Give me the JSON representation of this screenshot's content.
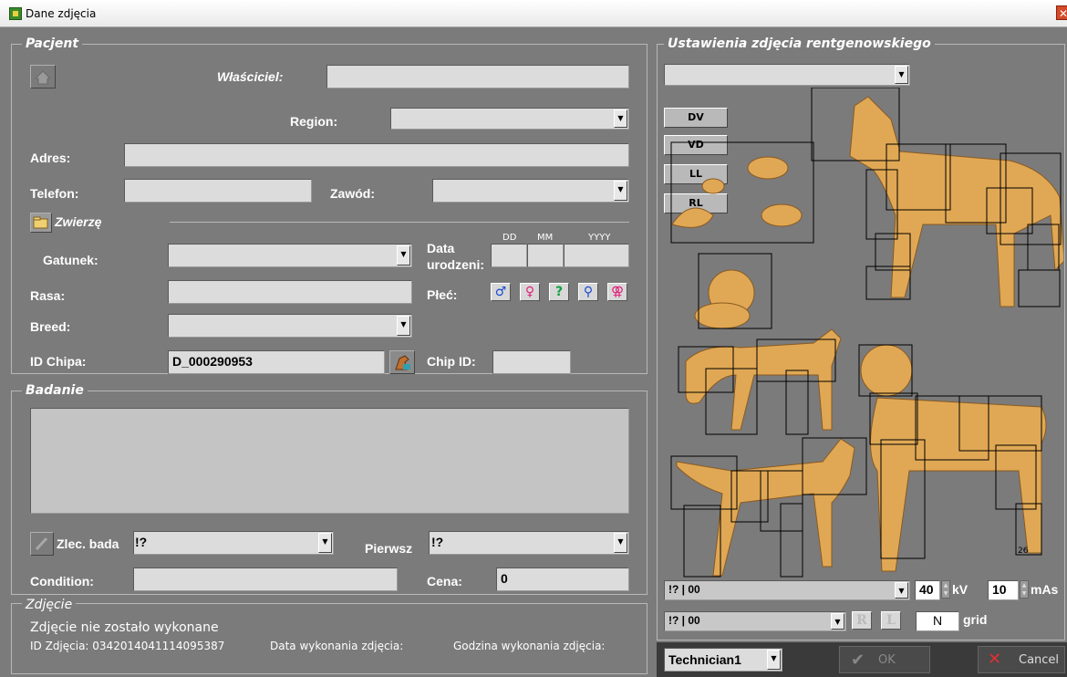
{
  "window": {
    "title": "Dane zdjęcia"
  },
  "patient": {
    "legend": "Pacjent",
    "owner_label": "Właściciel:",
    "owner_value": "",
    "region_label": "Region:",
    "region_value": "",
    "address_label": "Adres:",
    "address_value": "",
    "phone_label": "Telefon:",
    "phone_value": "",
    "profession_label": "Zawód:",
    "profession_value": "",
    "animal_legend": "Zwierzę",
    "species_label": "Gatunek:",
    "species_value": "",
    "birthdate_label_1": "Data",
    "birthdate_label_2": "urodzeni:",
    "date_dd": "DD",
    "date_mm": "MM",
    "date_yyyy": "YYYY",
    "breed_pl_label": "Rasa:",
    "breed_pl_value": "",
    "sex_label": "Płeć:",
    "sex_options": [
      "♂",
      "♀",
      "?",
      "⚲",
      "⚢"
    ],
    "breed_en_label": "Breed:",
    "breed_en_value": "",
    "chip_pl_label": "ID Chipa:",
    "chip_pl_value": "D_000290953",
    "chip_en_label": "Chip ID:",
    "chip_en_value": ""
  },
  "exam": {
    "legend": "Badanie",
    "notes": "",
    "order_label": "Zlec. bada",
    "order_value": "!?",
    "first_label": "Pierwsz",
    "first_value": "!?",
    "condition_label": "Condition:",
    "condition_value": "",
    "price_label": "Cena:",
    "price_value": "0"
  },
  "photo": {
    "legend": "Zdjęcie",
    "status": "Zdjęcie nie zostało wykonane",
    "id_text": "ID Zdjęcia: 0342014041114095387",
    "date_text": "Data wykonania zdjęcia:",
    "time_text": "Godzina wykonania zdjęcia:"
  },
  "xray": {
    "legend": "Ustawienia zdjęcia rentgenowskiego",
    "preset_value": "",
    "views": [
      "DV",
      "VD",
      "LL",
      "RL"
    ],
    "region_number": "26",
    "select1_value": "!? | 00",
    "select2_value": "!? | 00",
    "kv_value": "40",
    "kv_unit": "kV",
    "mas_value": "10",
    "mas_unit": "mAs",
    "r_label": "R",
    "l_label": "L",
    "grid_value": "N",
    "grid_label": "grid"
  },
  "footer": {
    "technician": "Technician1",
    "ok_label": "OK",
    "cancel_label": "Cancel"
  },
  "colors": {
    "bg": "#7b7b7b",
    "field": "#dcdcdc",
    "animal": "#e0a855"
  }
}
